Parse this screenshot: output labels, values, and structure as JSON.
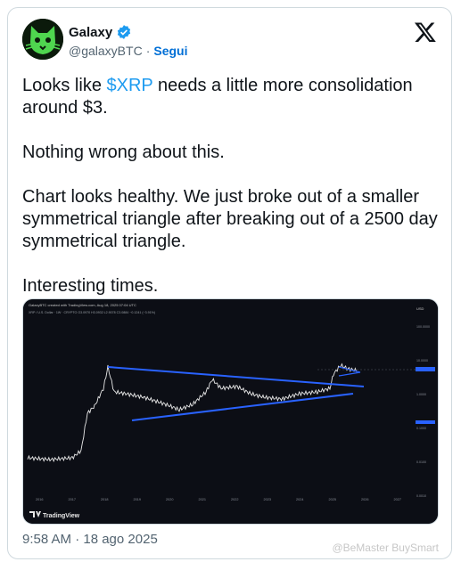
{
  "tweet": {
    "author_name": "Galaxy",
    "handle": "@galaxyBTC",
    "separator": "·",
    "follow_label": "Segui",
    "text_pre": "Looks like ",
    "cashtag": "$XRP",
    "text_post": " needs a little more consolidation around $3.",
    "para2": "Nothing wrong about this.",
    "para3": "Chart looks healthy. We just broke out of a smaller symmetrical triangle after breaking out of a 2500 day symmetrical triangle.",
    "para4": "Interesting times.",
    "timestamp": "9:58 AM · 18 ago 2025"
  },
  "media": {
    "header": "GalaxyBTC created with TradingView.com, Aug 18, 2025 07:04 UTC",
    "symbol_line": "XRP / U.S. Dollar · 1W · CRYPTO  O3.0970  H3.0932  L2.9078  C3.0884  −0.1241 (−3.91%)",
    "brand": "TradingView",
    "price_scale_label": "USD",
    "price_ticks": [
      "100.0000",
      "10.0000",
      "1.0000",
      "0.1000",
      "0.0100",
      "0.0010"
    ],
    "year_ticks": [
      "2016",
      "2017",
      "2018",
      "2019",
      "2020",
      "2021",
      "2022",
      "2023",
      "2024",
      "2025",
      "2026",
      "2027"
    ]
  },
  "watermark": "@BeMaster BuySmart",
  "colors": {
    "accent": "#1d9bf0",
    "follow": "#006fd6",
    "chart_bg": "#0c0e15",
    "candles": "#e8e8e8",
    "trendline": "#2962ff"
  }
}
